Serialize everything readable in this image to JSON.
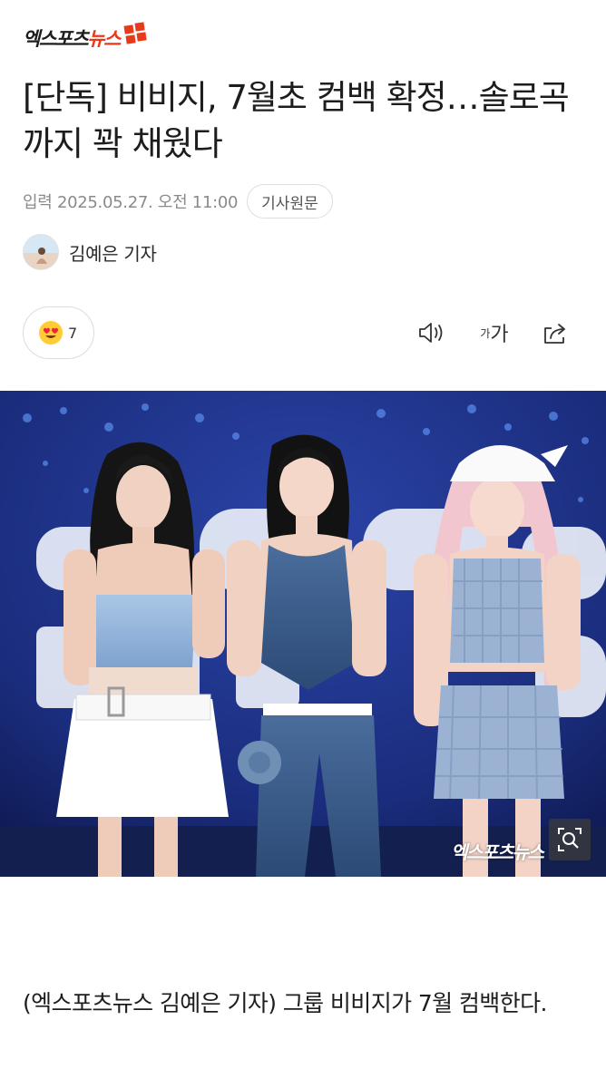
{
  "header": {
    "logo_text_black": "엑스포츠",
    "logo_text_red": "뉴스",
    "brand_color": "#e8391a"
  },
  "article": {
    "headline": "[단독] 비비지, 7월초 컴백 확정…솔로곡까지 꽉 채웠다",
    "date": "입력 2025.05.27. 오전 11:00",
    "source_button": "기사원문",
    "author": "김예은 기자",
    "body": "(엑스포츠뉴스 김예은 기자) 그룹 비비지가 7월 컴백한다."
  },
  "toolbar": {
    "reaction_icon": "heart-eyes-emoji-icon",
    "reaction_count": "7",
    "audio_icon": "speaker-icon",
    "font_small": "가",
    "font_big": "가",
    "share_icon": "share-icon"
  },
  "photo": {
    "watermark": "엑스포츠뉴스",
    "zoom_icon": "zoom-icon",
    "background_color": "#1b2d7a"
  }
}
